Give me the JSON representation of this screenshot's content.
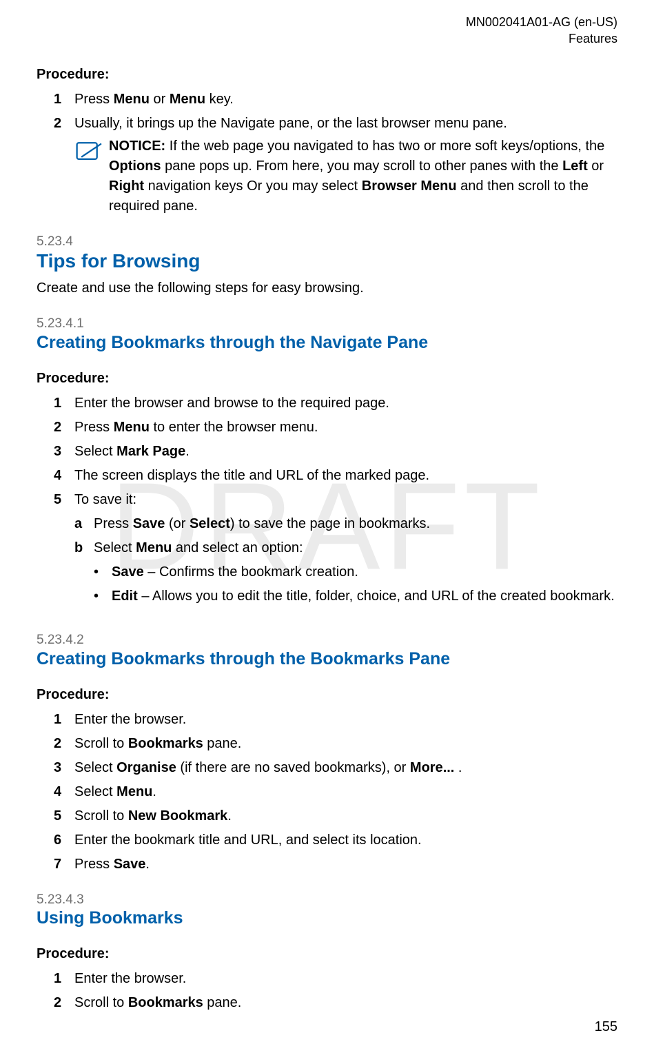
{
  "meta": {
    "doc_id": "MN002041A01-AG (en-US)",
    "chapter": "Features",
    "page_number": "155",
    "watermark": "DRAFT"
  },
  "top_procedure": {
    "label": "Procedure:",
    "steps": [
      {
        "num": "1",
        "segments": [
          {
            "t": "Press "
          },
          {
            "t": "Menu",
            "b": true
          },
          {
            "t": " or "
          },
          {
            "t": "Menu",
            "b": true
          },
          {
            "t": " key."
          }
        ]
      },
      {
        "num": "2",
        "segments": [
          {
            "t": "Usually, it brings up the Navigate pane, or the last browser menu pane."
          }
        ],
        "notice": {
          "label": "NOTICE:",
          "segments": [
            {
              "t": " If the web page you navigated to has two or more soft keys/options, the "
            },
            {
              "t": "Options",
              "b": true
            },
            {
              "t": " pane pops up. From here, you may scroll to other panes with the "
            },
            {
              "t": "Left",
              "b": true
            },
            {
              "t": " or "
            },
            {
              "t": "Right",
              "b": true
            },
            {
              "t": " navigation keys Or you may select "
            },
            {
              "t": "Browser Menu",
              "b": true
            },
            {
              "t": " and then scroll to the required pane."
            }
          ]
        }
      }
    ]
  },
  "sections": [
    {
      "num": "5.23.4",
      "title": "Tips for Browsing",
      "level": "h2",
      "desc": "Create and use the following steps for easy browsing."
    },
    {
      "num": "5.23.4.1",
      "title": "Creating Bookmarks through the Navigate Pane",
      "level": "h3",
      "procedure_label": "Procedure:",
      "steps": [
        {
          "num": "1",
          "segments": [
            {
              "t": "Enter the browser and browse to the required page."
            }
          ]
        },
        {
          "num": "2",
          "segments": [
            {
              "t": "Press "
            },
            {
              "t": "Menu",
              "b": true
            },
            {
              "t": " to enter the browser menu."
            }
          ]
        },
        {
          "num": "3",
          "segments": [
            {
              "t": "Select "
            },
            {
              "t": "Mark Page",
              "b": true
            },
            {
              "t": "."
            }
          ]
        },
        {
          "num": "4",
          "segments": [
            {
              "t": "The screen displays the title and URL of the marked page."
            }
          ]
        },
        {
          "num": "5",
          "segments": [
            {
              "t": "To save it:"
            }
          ],
          "substeps": [
            {
              "num": "a",
              "segments": [
                {
                  "t": "Press "
                },
                {
                  "t": "Save",
                  "b": true
                },
                {
                  "t": " (or "
                },
                {
                  "t": "Select",
                  "b": true
                },
                {
                  "t": ") to save the page in bookmarks."
                }
              ]
            },
            {
              "num": "b",
              "segments": [
                {
                  "t": "Select "
                },
                {
                  "t": "Menu",
                  "b": true
                },
                {
                  "t": " and select an option:"
                }
              ],
              "bullets": [
                {
                  "segments": [
                    {
                      "t": "Save",
                      "b": true
                    },
                    {
                      "t": " – Confirms the bookmark creation."
                    }
                  ]
                },
                {
                  "segments": [
                    {
                      "t": "Edit",
                      "b": true
                    },
                    {
                      "t": " – Allows you to edit the title, folder, choice, and URL of the created bookmark."
                    }
                  ]
                }
              ]
            }
          ]
        }
      ]
    },
    {
      "num": "5.23.4.2",
      "title": "Creating Bookmarks through the Bookmarks Pane",
      "level": "h3",
      "procedure_label": "Procedure:",
      "steps": [
        {
          "num": "1",
          "segments": [
            {
              "t": "Enter the browser."
            }
          ]
        },
        {
          "num": "2",
          "segments": [
            {
              "t": "Scroll to "
            },
            {
              "t": "Bookmarks",
              "b": true
            },
            {
              "t": " pane."
            }
          ]
        },
        {
          "num": "3",
          "segments": [
            {
              "t": "Select "
            },
            {
              "t": "Organise",
              "b": true
            },
            {
              "t": " (if there are no saved bookmarks), or "
            },
            {
              "t": "More...",
              "b": true
            },
            {
              "t": " ."
            }
          ]
        },
        {
          "num": "4",
          "segments": [
            {
              "t": "Select "
            },
            {
              "t": "Menu",
              "b": true
            },
            {
              "t": "."
            }
          ]
        },
        {
          "num": "5",
          "segments": [
            {
              "t": "Scroll to "
            },
            {
              "t": "New Bookmark",
              "b": true
            },
            {
              "t": "."
            }
          ]
        },
        {
          "num": "6",
          "segments": [
            {
              "t": "Enter the bookmark title and URL, and select its location."
            }
          ]
        },
        {
          "num": "7",
          "segments": [
            {
              "t": "Press "
            },
            {
              "t": "Save",
              "b": true
            },
            {
              "t": "."
            }
          ]
        }
      ]
    },
    {
      "num": "5.23.4.3",
      "title": "Using Bookmarks",
      "level": "h3",
      "procedure_label": "Procedure:",
      "steps": [
        {
          "num": "1",
          "segments": [
            {
              "t": "Enter the browser."
            }
          ]
        },
        {
          "num": "2",
          "segments": [
            {
              "t": "Scroll to "
            },
            {
              "t": "Bookmarks",
              "b": true
            },
            {
              "t": " pane."
            }
          ]
        }
      ]
    }
  ]
}
